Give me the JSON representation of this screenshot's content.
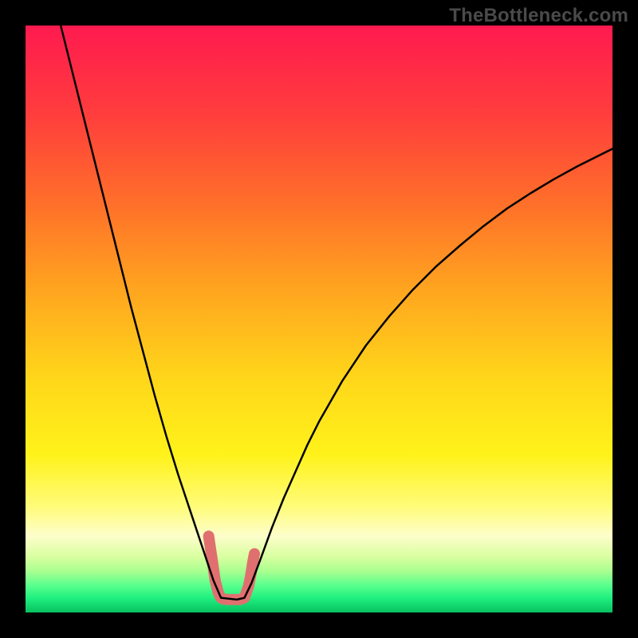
{
  "watermark": "TheBottleneck.com",
  "chart_data": {
    "type": "line",
    "title": "",
    "xlabel": "",
    "ylabel": "",
    "xlim": [
      0,
      100
    ],
    "ylim": [
      0,
      100
    ],
    "grid": false,
    "legend": false,
    "background_gradient_stops": [
      {
        "offset": 0.0,
        "color": "#ff1a4f"
      },
      {
        "offset": 0.15,
        "color": "#ff3d3d"
      },
      {
        "offset": 0.3,
        "color": "#ff6e2a"
      },
      {
        "offset": 0.45,
        "color": "#ffa51f"
      },
      {
        "offset": 0.6,
        "color": "#ffd61a"
      },
      {
        "offset": 0.73,
        "color": "#fff21a"
      },
      {
        "offset": 0.82,
        "color": "#fffc7a"
      },
      {
        "offset": 0.87,
        "color": "#fdfecb"
      },
      {
        "offset": 0.905,
        "color": "#d9ffa0"
      },
      {
        "offset": 0.93,
        "color": "#a8ff90"
      },
      {
        "offset": 0.955,
        "color": "#56ff8d"
      },
      {
        "offset": 0.975,
        "color": "#20f07f"
      },
      {
        "offset": 1.0,
        "color": "#08c060"
      }
    ],
    "series": [
      {
        "name": "curve-black",
        "color": "#000000",
        "stroke_width": 2.5,
        "x": [
          6.0,
          8.0,
          10.0,
          12.0,
          14.0,
          16.0,
          18.0,
          20.0,
          22.0,
          24.0,
          26.0,
          28.0,
          30.0,
          31.0,
          32.0,
          33.3,
          36.0,
          37.3,
          38.5,
          40.0,
          42.0,
          44.0,
          46.0,
          48.0,
          50.0,
          54.0,
          58.0,
          62.0,
          66.0,
          70.0,
          74.0,
          78.0,
          82.0,
          86.0,
          90.0,
          94.0,
          98.0,
          100.0
        ],
        "y": [
          100.0,
          92.0,
          84.0,
          76.0,
          68.0,
          60.0,
          52.0,
          44.5,
          37.0,
          30.0,
          23.5,
          17.5,
          11.5,
          8.5,
          5.5,
          2.5,
          2.2,
          2.5,
          5.0,
          9.0,
          14.5,
          19.5,
          24.0,
          28.5,
          32.5,
          39.5,
          45.5,
          50.5,
          55.0,
          59.0,
          62.5,
          65.8,
          68.8,
          71.4,
          73.8,
          76.0,
          78.0,
          79.0
        ]
      },
      {
        "name": "marker-pink",
        "color": "#e0706f",
        "stroke_width": 14,
        "x": [
          31.2,
          31.8,
          32.3,
          32.8,
          33.2,
          33.6,
          34.5,
          35.5,
          36.5,
          37.3,
          38.0,
          38.4,
          38.7,
          39.0
        ],
        "y": [
          13.0,
          9.0,
          5.5,
          3.5,
          2.6,
          2.3,
          2.2,
          2.2,
          2.2,
          2.5,
          4.5,
          6.5,
          8.5,
          10.0
        ]
      }
    ]
  }
}
